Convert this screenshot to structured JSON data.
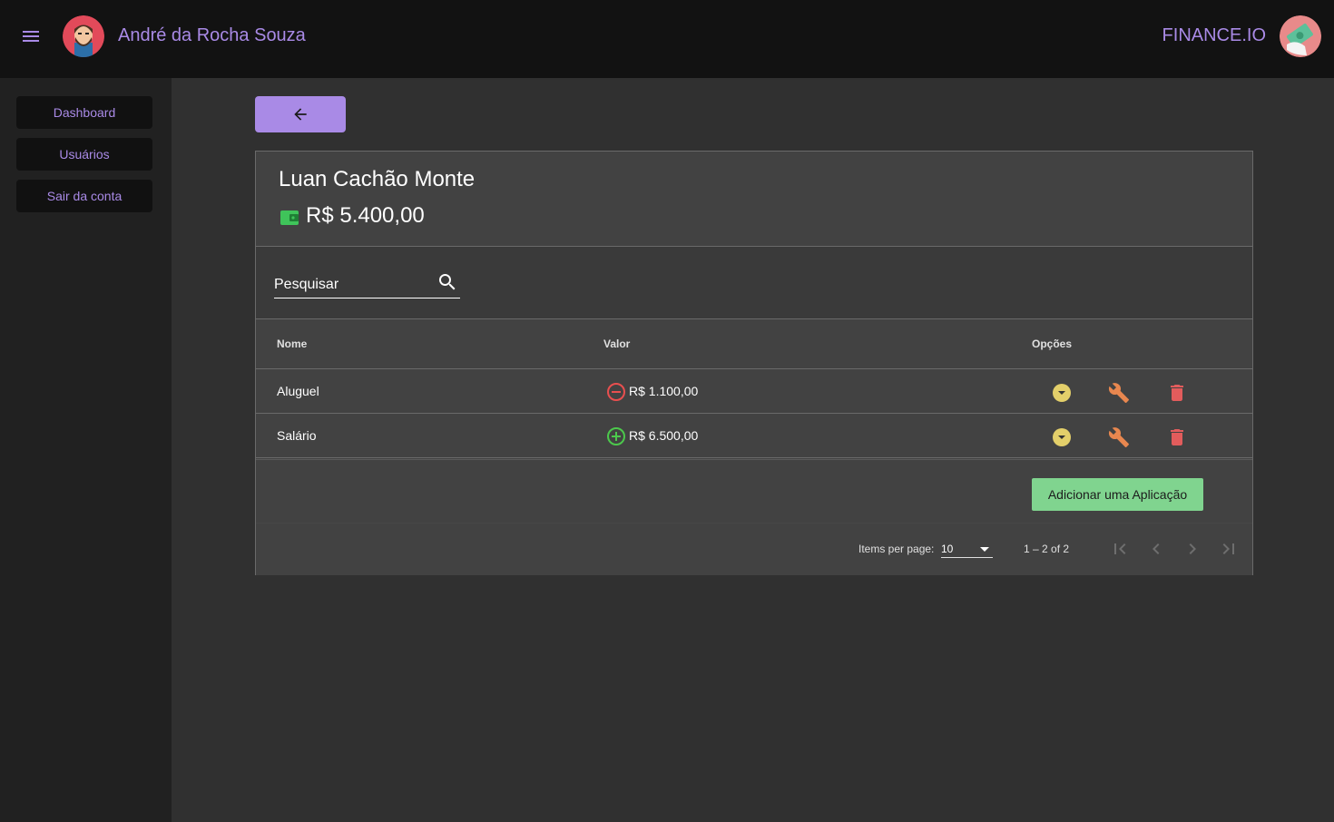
{
  "header": {
    "user_name": "André da Rocha Souza",
    "brand": "FINANCE.IO",
    "menu_icon": "menu-icon",
    "accent": "#a98ae6"
  },
  "sidebar": {
    "items": [
      {
        "label": "Dashboard"
      },
      {
        "label": "Usuários"
      },
      {
        "label": "Sair da conta"
      }
    ]
  },
  "client": {
    "name": "Luan Cachão Monte",
    "balance": "R$ 5.400,00"
  },
  "search": {
    "placeholder": "Pesquisar"
  },
  "table": {
    "headers": {
      "name": "Nome",
      "value": "Valor",
      "options": "Opções"
    },
    "rows": [
      {
        "name": "Aluguel",
        "value": "R$ 1.100,00",
        "type": "expense",
        "type_color": "#e84f4f"
      },
      {
        "name": "Salário",
        "value": "R$ 6.500,00",
        "type": "income",
        "type_color": "#4cc84c"
      }
    ]
  },
  "actions": {
    "add_label": "Adicionar uma Aplicação",
    "add_color": "#80d48f"
  },
  "paginator": {
    "items_per_page_label": "Items per page:",
    "items_per_page": "10",
    "range": "1 – 2 of 2"
  }
}
